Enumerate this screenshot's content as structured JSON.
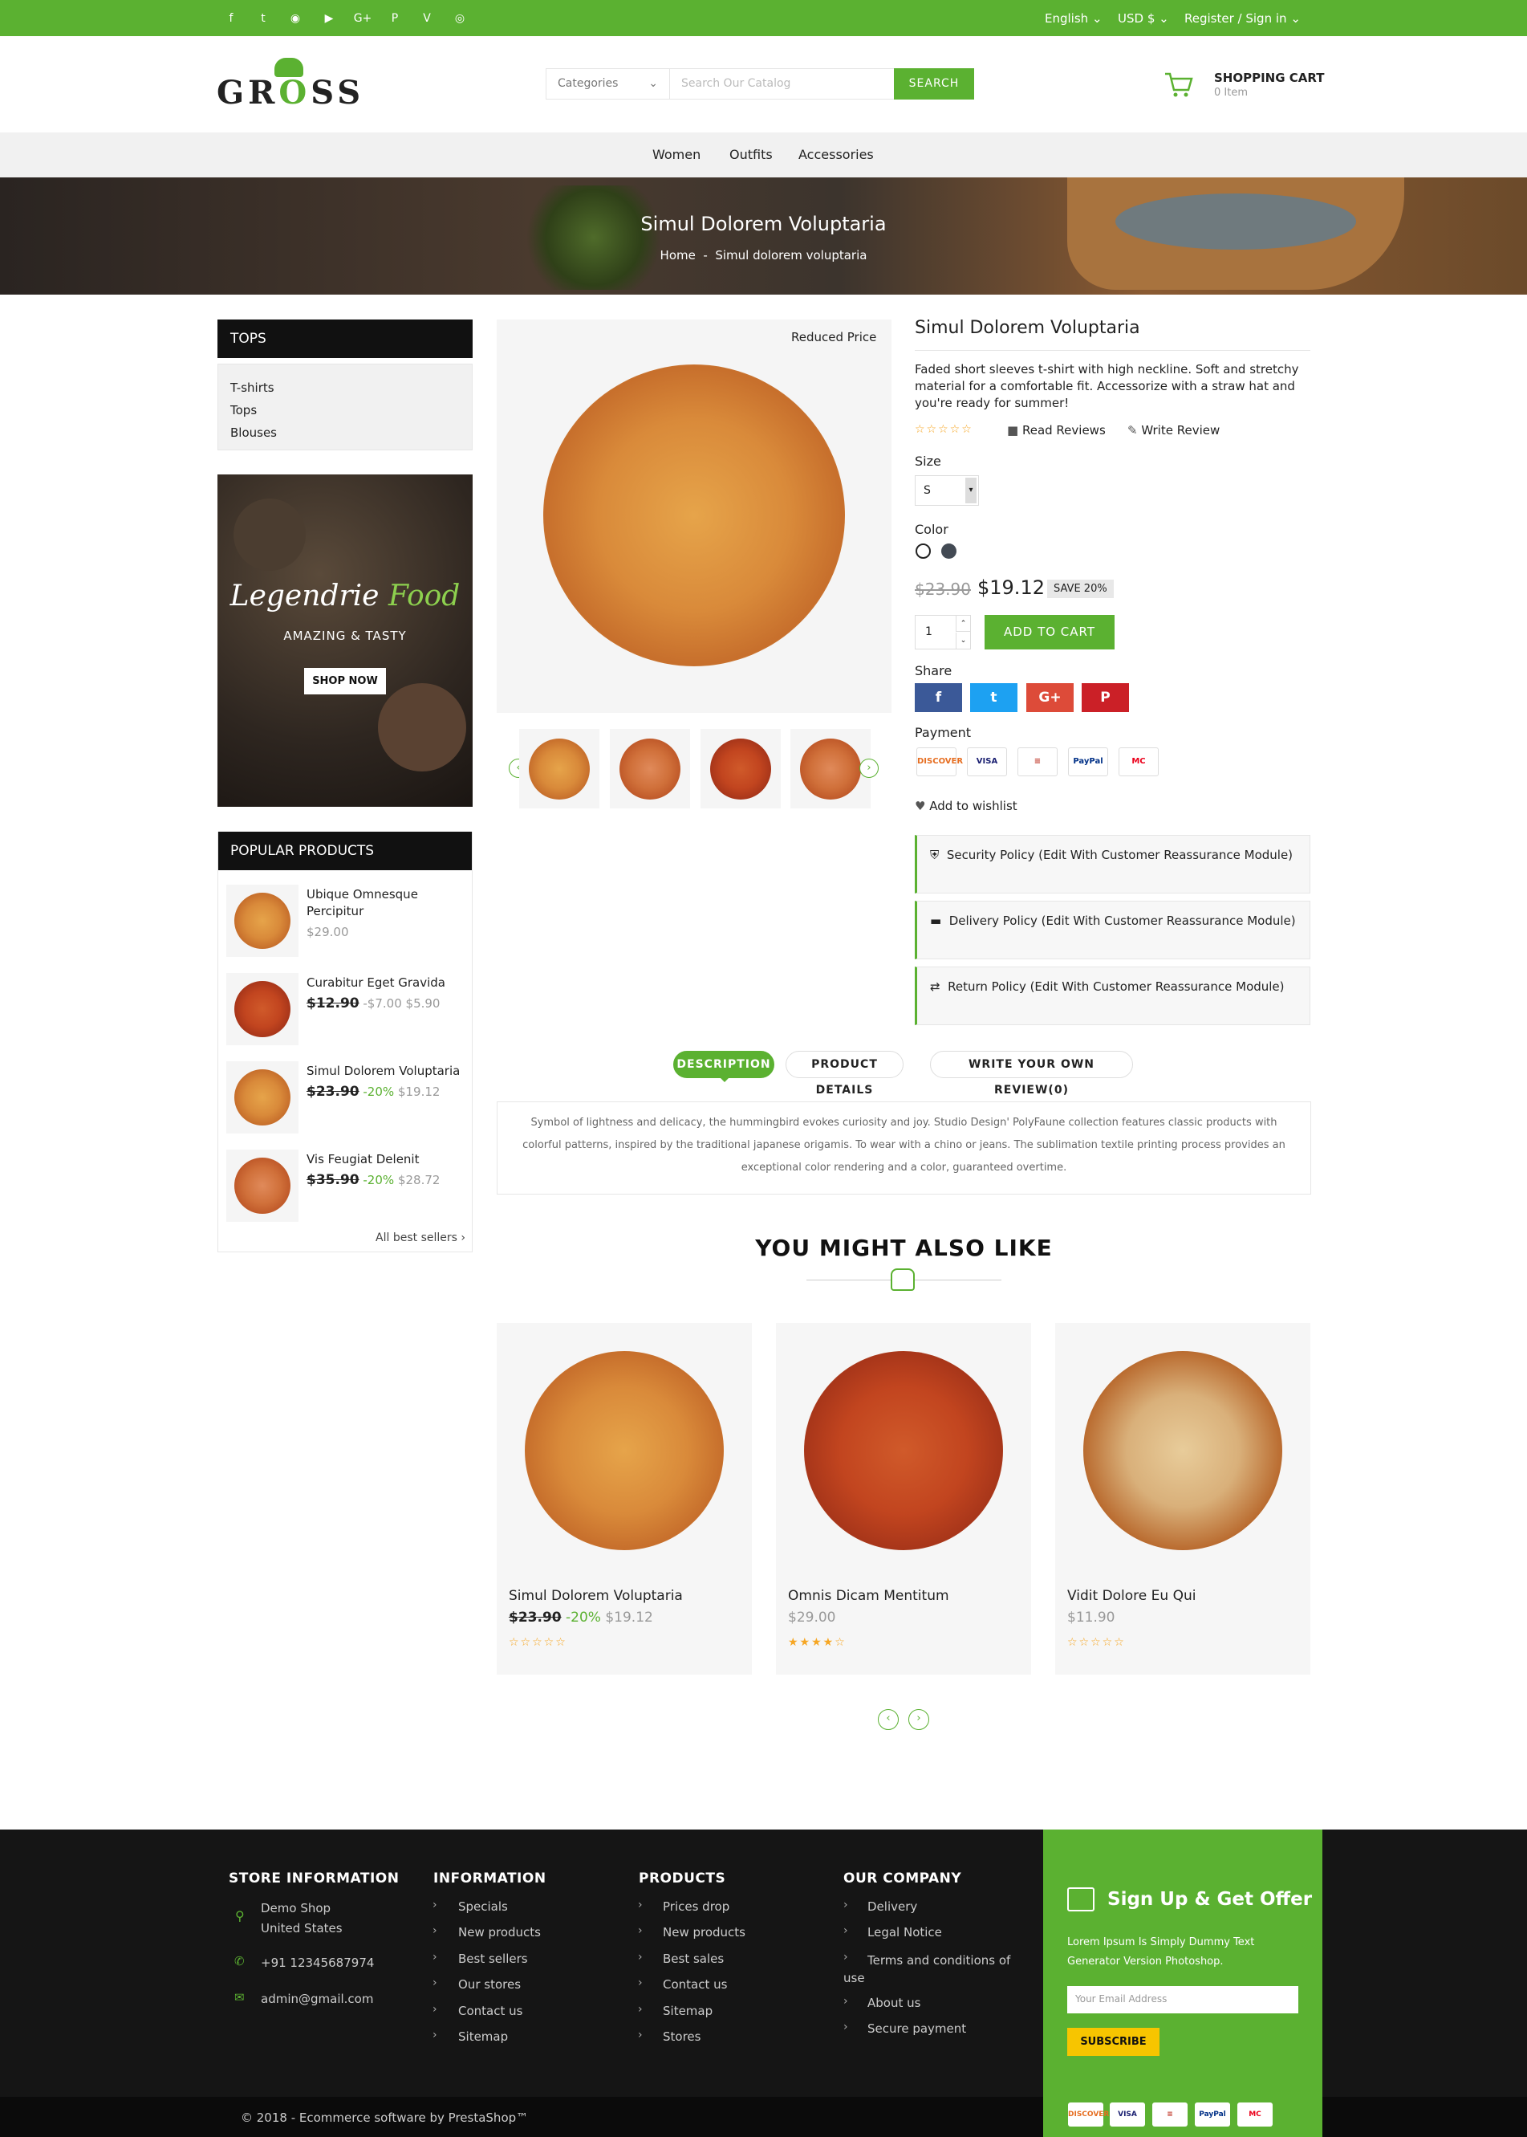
{
  "social_icons": [
    "facebook-icon",
    "twitter-icon",
    "rss-icon",
    "youtube-icon",
    "google-plus-icon",
    "pinterest-icon",
    "vimeo-icon",
    "instagram-icon"
  ],
  "topbar": {
    "language": "English",
    "currency": "USD $",
    "register": "Register",
    "sign_in": "Sign in"
  },
  "logo": {
    "text_pre": "GR",
    "text_o": "O",
    "text_post": "SS"
  },
  "search": {
    "category": "Categories",
    "placeholder": "Search Our Catalog",
    "button": "SEARCH"
  },
  "cart": {
    "title": "SHOPPING CART",
    "count": "0 Item"
  },
  "nav": [
    "Women",
    "Outfits",
    "Accessories"
  ],
  "banner": {
    "title": "Simul Dolorem Voluptaria",
    "crumb_home": "Home",
    "crumb_sep": "-",
    "crumb_current": "Simul dolorem voluptaria"
  },
  "sidebar": {
    "tops_title": "TOPS",
    "tops_links": [
      "T-shirts",
      "Tops",
      "Blouses"
    ],
    "promo": {
      "title_a": "Legendrie",
      "title_b": "Food",
      "subtitle": "AMAZING & TASTY",
      "button": "SHOP NOW"
    },
    "popular_title": "POPULAR PRODUCTS",
    "popular": [
      {
        "name": "Ubique Omnesque Percipitur",
        "old": "",
        "discount": "",
        "price": "$29.00"
      },
      {
        "name": "Curabitur Eget Gravida",
        "old": "$12.90",
        "discount": "-$7.00",
        "price": "$5.90"
      },
      {
        "name": "Simul Dolorem Voluptaria",
        "old": "$23.90",
        "discount": "-20%",
        "price": "$19.12"
      },
      {
        "name": "Vis Feugiat Delenit",
        "old": "$35.90",
        "discount": "-20%",
        "price": "$28.72"
      }
    ],
    "all_best": "All best sellers"
  },
  "product": {
    "badge": "Reduced Price",
    "title": "Simul Dolorem Voluptaria",
    "description": "Faded short sleeves t-shirt with high neckline. Soft and stretchy material for a comfortable fit. Accessorize with a straw hat and you're ready for summer!",
    "rating_stars": "☆☆☆☆☆",
    "read_reviews": "Read Reviews",
    "write_review": "Write Review",
    "size_label": "Size",
    "size_value": "S",
    "color_label": "Color",
    "old_price": "$23.90",
    "price": "$19.12",
    "save": "SAVE 20%",
    "qty": "1",
    "add_to_cart": "ADD TO CART",
    "share_label": "Share",
    "payment_label": "Payment",
    "payments": [
      "DISCOVER",
      "VISA",
      "≡",
      "PayPal",
      "MC"
    ],
    "wishlist": "Add to wishlist",
    "reassurance": [
      "Security Policy (Edit With Customer Reassurance Module)",
      "Delivery Policy (Edit With Customer Reassurance Module)",
      "Return Policy (Edit With Customer Reassurance Module)"
    ]
  },
  "tabs": [
    "DESCRIPTION",
    "PRODUCT DETAILS",
    "WRITE YOUR OWN REVIEW(0)"
  ],
  "description_text": "Symbol of lightness and delicacy, the hummingbird evokes curiosity and joy. Studio Design' PolyFaune collection features classic products with colorful patterns, inspired by the traditional japanese origamis. To wear with a chino or jeans. The sublimation textile printing process provides an exceptional color rendering and a color, guaranteed overtime.",
  "related": {
    "title": "YOU MIGHT ALSO LIKE",
    "items": [
      {
        "name": "Simul Dolorem Voluptaria",
        "old": "$23.90",
        "discount": "-20%",
        "price": "$19.12",
        "stars": "☆☆☆☆☆"
      },
      {
        "name": "Omnis Dicam Mentitum",
        "old": "",
        "discount": "",
        "price": "$29.00",
        "stars": "★★★★☆"
      },
      {
        "name": "Vidit Dolore Eu Qui",
        "old": "",
        "discount": "",
        "price": "$11.90",
        "stars": "☆☆☆☆☆"
      }
    ]
  },
  "footer": {
    "store": {
      "title": "STORE INFORMATION",
      "address1": "Demo Shop",
      "address2": "United States",
      "phone": "+91 12345687974",
      "email": "admin@gmail.com"
    },
    "information": {
      "title": "INFORMATION",
      "links": [
        "Specials",
        "New products",
        "Best sellers",
        "Our stores",
        "Contact us",
        "Sitemap"
      ]
    },
    "products": {
      "title": "PRODUCTS",
      "links": [
        "Prices drop",
        "New products",
        "Best sales",
        "Contact us",
        "Sitemap",
        "Stores"
      ]
    },
    "company": {
      "title": "OUR COMPANY",
      "links": [
        "Delivery",
        "Legal Notice",
        "Terms and conditions of use",
        "About us",
        "Secure payment"
      ]
    },
    "signup": {
      "title": "Sign Up & Get Offer",
      "text": "Lorem Ipsum Is Simply Dummy Text Generator Version Photoshop.",
      "placeholder": "Your Email Address",
      "button": "SUBSCRIBE"
    },
    "copyright": "© 2018 - Ecommerce software by PrestaShop™"
  },
  "colors": {
    "accent": "#5bb131",
    "facebook": "#3b5998",
    "twitter": "#1da1f2",
    "google": "#dd4b39",
    "pinterest": "#cb2027"
  }
}
